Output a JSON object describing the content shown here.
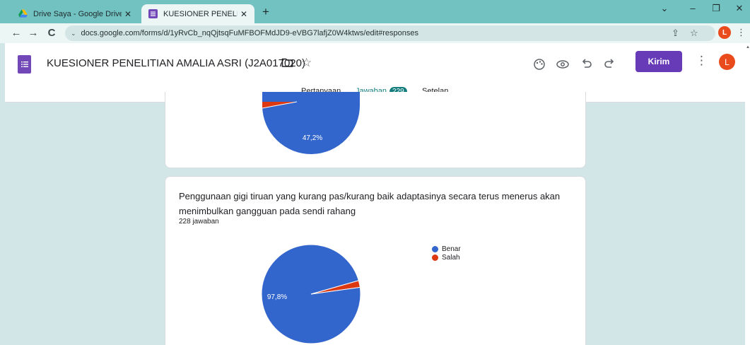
{
  "browser": {
    "tabs": [
      {
        "title": "Drive Saya - Google Drive",
        "active": false
      },
      {
        "title": "KUESIONER PENELITIAN AMALIA",
        "active": true
      }
    ],
    "new_tab": "+",
    "url": "docs.google.com/forms/d/1yRvCb_nqQjtsqFuMFBOFMdJD9-eVBG7lafjZ0W4ktws/edit#responses",
    "profile_initial": "L"
  },
  "form": {
    "title": "KUESIONER PENELITIAN AMALIA ASRI (J2A017020)",
    "send_label": "Kirim",
    "profile_initial": "L",
    "tabs": [
      {
        "label": "Pertanyaan"
      },
      {
        "label": "Jawaban",
        "badge": "229"
      },
      {
        "label": "Setelan"
      }
    ]
  },
  "question1": {
    "chart_data": {
      "type": "pie",
      "visible_label": "47,2%"
    }
  },
  "question2": {
    "title": "Penggunaan gigi tiruan yang kurang pas/kurang baik adaptasinya secara terus menerus akan menimbulkan gangguan pada sendi rahang",
    "count": "228 jawaban",
    "chart_data": {
      "type": "pie",
      "categories": [
        "Benar",
        "Salah"
      ],
      "values": [
        97.8,
        2.2
      ],
      "colors": [
        "#3366cc",
        "#dc3912"
      ],
      "visible_label": "97,8%",
      "legend_position": "right"
    }
  },
  "colors": {
    "accent": "#673ab7",
    "teal": "#137d7d",
    "pie_blue": "#3366cc",
    "pie_red": "#dc3912",
    "background": "#d2e6e7"
  }
}
